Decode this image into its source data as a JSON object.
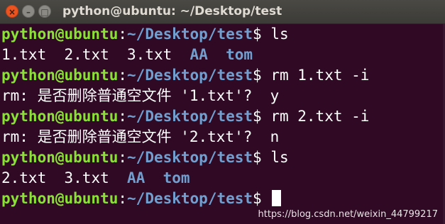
{
  "window": {
    "title": "python@ubuntu: ~/Desktop/test",
    "close_glyph": "×",
    "minimize_glyph": "–",
    "maximize_glyph": "□"
  },
  "colors": {
    "terminal_background": "#300a24",
    "prompt_user": "#8ae234",
    "prompt_path": "#729fcf",
    "directory": "#729fcf",
    "text": "#ffffff",
    "close_button": "#e95420"
  },
  "terminal": {
    "prompt": {
      "user_host": "python@ubuntu",
      "separator": ":",
      "path": "~/Desktop/test",
      "symbol": "$"
    },
    "lines": [
      {
        "type": "command",
        "command": " ls"
      },
      {
        "type": "listing",
        "files": [
          "1.txt",
          "2.txt",
          "3.txt"
        ],
        "dirs": [
          "AA",
          "tom"
        ]
      },
      {
        "type": "command",
        "command": " rm 1.txt -i"
      },
      {
        "type": "output",
        "text": "rm: 是否删除普通空文件 '1.txt'?  y"
      },
      {
        "type": "command",
        "command": " rm 2.txt -i"
      },
      {
        "type": "output",
        "text": "rm: 是否删除普通空文件 '2.txt'?  n"
      },
      {
        "type": "command",
        "command": " ls"
      },
      {
        "type": "listing",
        "files": [
          "2.txt",
          "3.txt"
        ],
        "dirs": [
          "AA",
          "tom"
        ]
      },
      {
        "type": "command",
        "command": " "
      }
    ],
    "cursor": "block"
  },
  "watermark": "https://blog.csdn.net/weixin_44799217"
}
